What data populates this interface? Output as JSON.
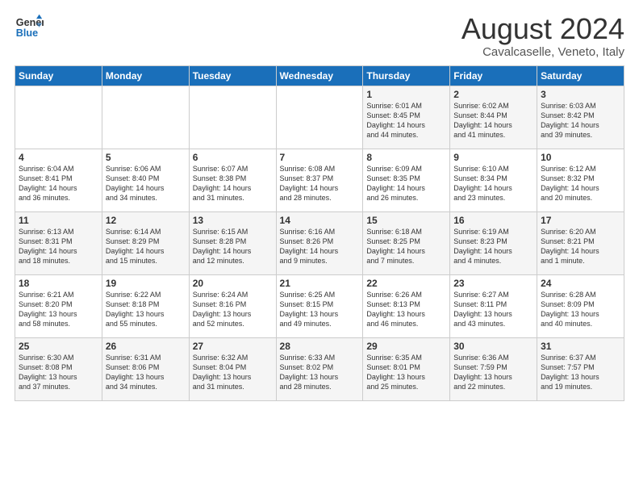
{
  "logo": {
    "line1": "General",
    "line2": "Blue"
  },
  "title": "August 2024",
  "subtitle": "Cavalcaselle, Veneto, Italy",
  "weekdays": [
    "Sunday",
    "Monday",
    "Tuesday",
    "Wednesday",
    "Thursday",
    "Friday",
    "Saturday"
  ],
  "weeks": [
    [
      {
        "day": "",
        "info": ""
      },
      {
        "day": "",
        "info": ""
      },
      {
        "day": "",
        "info": ""
      },
      {
        "day": "",
        "info": ""
      },
      {
        "day": "1",
        "info": "Sunrise: 6:01 AM\nSunset: 8:45 PM\nDaylight: 14 hours\nand 44 minutes."
      },
      {
        "day": "2",
        "info": "Sunrise: 6:02 AM\nSunset: 8:44 PM\nDaylight: 14 hours\nand 41 minutes."
      },
      {
        "day": "3",
        "info": "Sunrise: 6:03 AM\nSunset: 8:42 PM\nDaylight: 14 hours\nand 39 minutes."
      }
    ],
    [
      {
        "day": "4",
        "info": "Sunrise: 6:04 AM\nSunset: 8:41 PM\nDaylight: 14 hours\nand 36 minutes."
      },
      {
        "day": "5",
        "info": "Sunrise: 6:06 AM\nSunset: 8:40 PM\nDaylight: 14 hours\nand 34 minutes."
      },
      {
        "day": "6",
        "info": "Sunrise: 6:07 AM\nSunset: 8:38 PM\nDaylight: 14 hours\nand 31 minutes."
      },
      {
        "day": "7",
        "info": "Sunrise: 6:08 AM\nSunset: 8:37 PM\nDaylight: 14 hours\nand 28 minutes."
      },
      {
        "day": "8",
        "info": "Sunrise: 6:09 AM\nSunset: 8:35 PM\nDaylight: 14 hours\nand 26 minutes."
      },
      {
        "day": "9",
        "info": "Sunrise: 6:10 AM\nSunset: 8:34 PM\nDaylight: 14 hours\nand 23 minutes."
      },
      {
        "day": "10",
        "info": "Sunrise: 6:12 AM\nSunset: 8:32 PM\nDaylight: 14 hours\nand 20 minutes."
      }
    ],
    [
      {
        "day": "11",
        "info": "Sunrise: 6:13 AM\nSunset: 8:31 PM\nDaylight: 14 hours\nand 18 minutes."
      },
      {
        "day": "12",
        "info": "Sunrise: 6:14 AM\nSunset: 8:29 PM\nDaylight: 14 hours\nand 15 minutes."
      },
      {
        "day": "13",
        "info": "Sunrise: 6:15 AM\nSunset: 8:28 PM\nDaylight: 14 hours\nand 12 minutes."
      },
      {
        "day": "14",
        "info": "Sunrise: 6:16 AM\nSunset: 8:26 PM\nDaylight: 14 hours\nand 9 minutes."
      },
      {
        "day": "15",
        "info": "Sunrise: 6:18 AM\nSunset: 8:25 PM\nDaylight: 14 hours\nand 7 minutes."
      },
      {
        "day": "16",
        "info": "Sunrise: 6:19 AM\nSunset: 8:23 PM\nDaylight: 14 hours\nand 4 minutes."
      },
      {
        "day": "17",
        "info": "Sunrise: 6:20 AM\nSunset: 8:21 PM\nDaylight: 14 hours\nand 1 minute."
      }
    ],
    [
      {
        "day": "18",
        "info": "Sunrise: 6:21 AM\nSunset: 8:20 PM\nDaylight: 13 hours\nand 58 minutes."
      },
      {
        "day": "19",
        "info": "Sunrise: 6:22 AM\nSunset: 8:18 PM\nDaylight: 13 hours\nand 55 minutes."
      },
      {
        "day": "20",
        "info": "Sunrise: 6:24 AM\nSunset: 8:16 PM\nDaylight: 13 hours\nand 52 minutes."
      },
      {
        "day": "21",
        "info": "Sunrise: 6:25 AM\nSunset: 8:15 PM\nDaylight: 13 hours\nand 49 minutes."
      },
      {
        "day": "22",
        "info": "Sunrise: 6:26 AM\nSunset: 8:13 PM\nDaylight: 13 hours\nand 46 minutes."
      },
      {
        "day": "23",
        "info": "Sunrise: 6:27 AM\nSunset: 8:11 PM\nDaylight: 13 hours\nand 43 minutes."
      },
      {
        "day": "24",
        "info": "Sunrise: 6:28 AM\nSunset: 8:09 PM\nDaylight: 13 hours\nand 40 minutes."
      }
    ],
    [
      {
        "day": "25",
        "info": "Sunrise: 6:30 AM\nSunset: 8:08 PM\nDaylight: 13 hours\nand 37 minutes."
      },
      {
        "day": "26",
        "info": "Sunrise: 6:31 AM\nSunset: 8:06 PM\nDaylight: 13 hours\nand 34 minutes."
      },
      {
        "day": "27",
        "info": "Sunrise: 6:32 AM\nSunset: 8:04 PM\nDaylight: 13 hours\nand 31 minutes."
      },
      {
        "day": "28",
        "info": "Sunrise: 6:33 AM\nSunset: 8:02 PM\nDaylight: 13 hours\nand 28 minutes."
      },
      {
        "day": "29",
        "info": "Sunrise: 6:35 AM\nSunset: 8:01 PM\nDaylight: 13 hours\nand 25 minutes."
      },
      {
        "day": "30",
        "info": "Sunrise: 6:36 AM\nSunset: 7:59 PM\nDaylight: 13 hours\nand 22 minutes."
      },
      {
        "day": "31",
        "info": "Sunrise: 6:37 AM\nSunset: 7:57 PM\nDaylight: 13 hours\nand 19 minutes."
      }
    ]
  ]
}
